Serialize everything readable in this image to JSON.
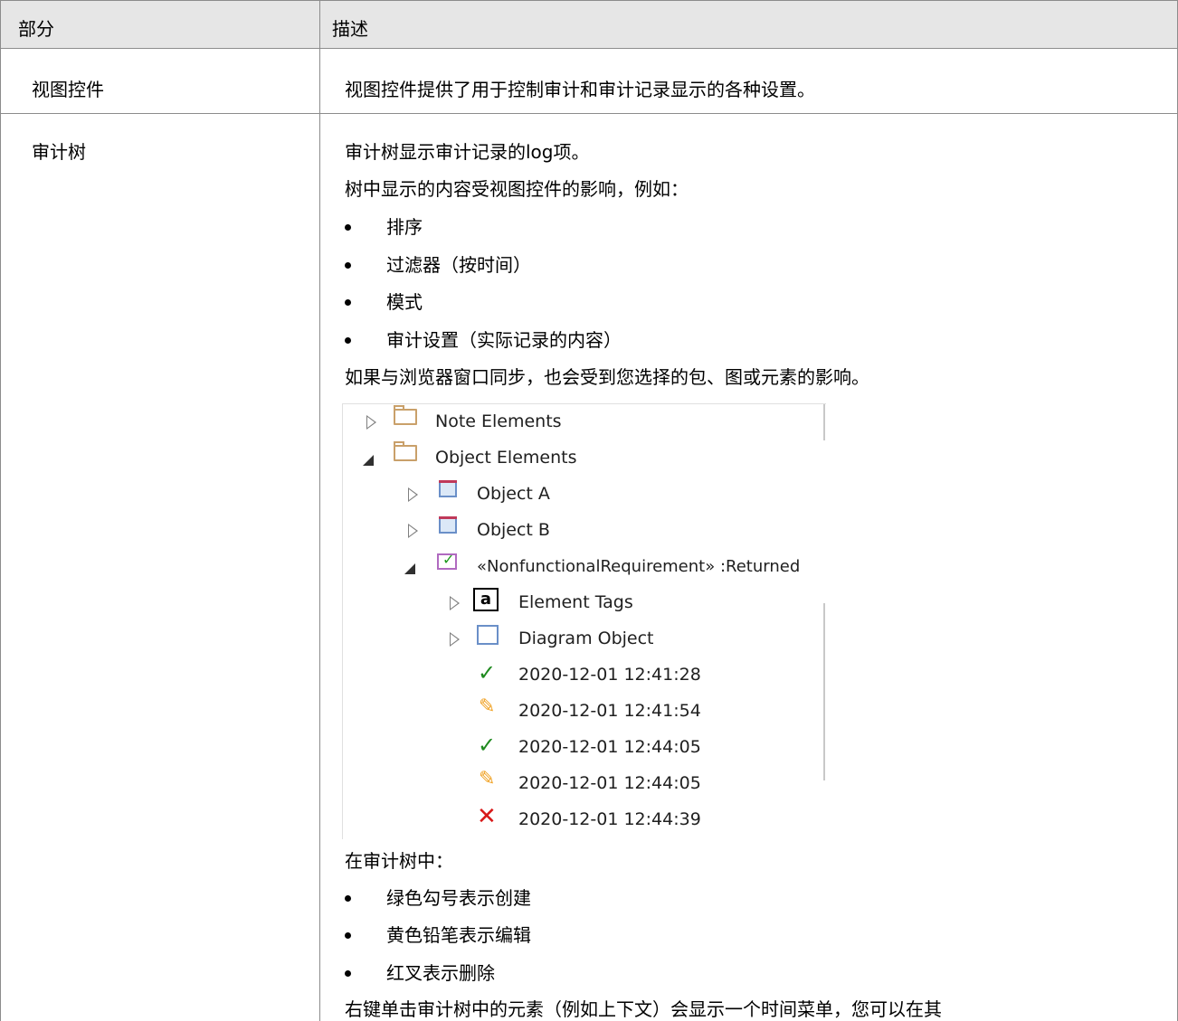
{
  "table": {
    "headers": [
      "部分",
      "描述"
    ],
    "rows": [
      {
        "section": "视图控件",
        "description": "视图控件提供了用于控制审计和审计记录显示的各种设置。"
      },
      {
        "section": "审计树",
        "intro": "审计树显示审计记录的log项。",
        "affected_by": "树中显示的内容受视图控件的影响，例如：",
        "factors": [
          "排序",
          "过滤器（按时间）",
          "模式",
          "审计设置（实际记录的内容）"
        ],
        "sync_note": "如果与浏览器窗口同步，也会受到您选择的包、图或元素的影响。",
        "legend_intro": "在审计树中：",
        "legend": [
          "绿色勾号表示创建",
          "黄色铅笔表示编辑",
          "红叉表示删除"
        ],
        "context_note": "右键单击审计树中的元素（例如上下文）会显示一个时间菜单，您可以在其"
      }
    ]
  },
  "tree": {
    "items": [
      {
        "label": "Note Elements",
        "icon": "folder-icon",
        "expander": "collapsed"
      },
      {
        "label": "Object Elements",
        "icon": "folder-icon",
        "expander": "expanded"
      },
      {
        "label": "Object A",
        "icon": "object-icon",
        "expander": "collapsed"
      },
      {
        "label": "Object B",
        "icon": "object-icon",
        "expander": "collapsed"
      },
      {
        "label": "«NonfunctionalRequirement» :Returned",
        "icon": "requirement-icon",
        "expander": "expanded"
      },
      {
        "label": "Element Tags",
        "icon": "tag-icon",
        "icon_text": "a",
        "expander": "collapsed"
      },
      {
        "label": "Diagram Object",
        "icon": "diagram-object-icon",
        "expander": "collapsed"
      },
      {
        "label": "2020-12-01 12:41:28",
        "icon": "green-check-icon"
      },
      {
        "label": "2020-12-01 12:41:54",
        "icon": "yellow-pencil-icon"
      },
      {
        "label": "2020-12-01 12:44:05",
        "icon": "green-check-icon"
      },
      {
        "label": "2020-12-01 12:44:05",
        "icon": "yellow-pencil-icon"
      },
      {
        "label": "2020-12-01 12:44:39",
        "icon": "red-cross-icon"
      }
    ]
  },
  "colors": {
    "header_bg": "#e6e6e6",
    "border": "#8c8c8c",
    "create": "#1f8a1f",
    "edit": "#f0a020",
    "delete": "#d81818"
  }
}
